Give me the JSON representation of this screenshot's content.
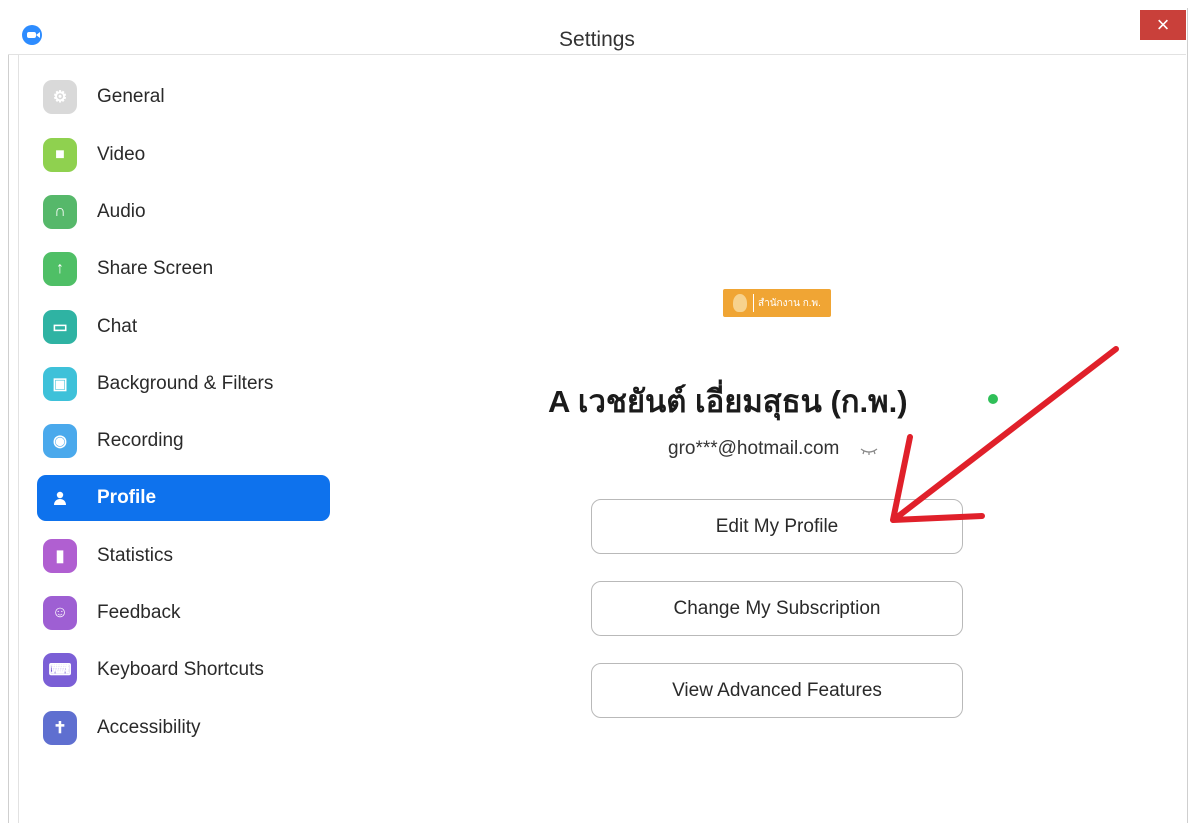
{
  "window": {
    "title": "Settings",
    "close_glyph": "×"
  },
  "sidebar": {
    "items": [
      {
        "label": "General",
        "icon": "gear-icon",
        "color": "#d9d9d9",
        "glyph": "⚙"
      },
      {
        "label": "Video",
        "icon": "video-camera-icon",
        "color": "#8fd14f",
        "glyph": "■"
      },
      {
        "label": "Audio",
        "icon": "headphones-icon",
        "color": "#56b86a",
        "glyph": "∩"
      },
      {
        "label": "Share Screen",
        "icon": "share-screen-icon",
        "color": "#4fbf66",
        "glyph": "↑"
      },
      {
        "label": "Chat",
        "icon": "chat-icon",
        "color": "#2fb3a3",
        "glyph": "▭"
      },
      {
        "label": "Background & Filters",
        "icon": "background-icon",
        "color": "#3ec1d9",
        "glyph": "▣"
      },
      {
        "label": "Recording",
        "icon": "recording-icon",
        "color": "#4aa9ec",
        "glyph": "◉"
      },
      {
        "label": "Profile",
        "icon": "profile-icon",
        "color": "#0e72ed",
        "glyph": "●",
        "active": true
      },
      {
        "label": "Statistics",
        "icon": "statistics-icon",
        "color": "#b05fd1",
        "glyph": "▮"
      },
      {
        "label": "Feedback",
        "icon": "feedback-icon",
        "color": "#9e5fd3",
        "glyph": "☺"
      },
      {
        "label": "Keyboard Shortcuts",
        "icon": "keyboard-icon",
        "color": "#7b5fd6",
        "glyph": "⌨"
      },
      {
        "label": "Accessibility",
        "icon": "accessibility-icon",
        "color": "#5f6fd0",
        "glyph": "✝"
      }
    ]
  },
  "profile": {
    "display_name": "A  เวชยันต์ เอี่ยมสุธน (ก.พ.)",
    "email": "gro***@hotmail.com",
    "logo_text": "สำนักงาน ก.พ.",
    "status_color": "#2fbf58",
    "buttons": {
      "edit": "Edit My Profile",
      "subscription": "Change My Subscription",
      "advanced": "View Advanced Features"
    }
  },
  "colors": {
    "accent": "#0e72ed",
    "close": "#c9403a",
    "annotation_arrow": "#e0202a"
  }
}
